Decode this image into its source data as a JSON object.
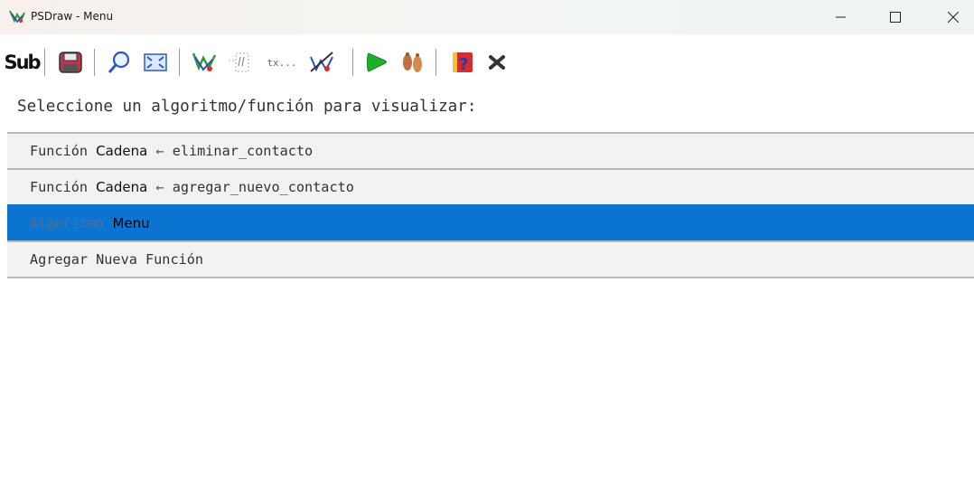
{
  "window": {
    "title": "PSDraw - Menu",
    "controls": {
      "minimize": "—",
      "maximize": "☐",
      "close": "✕"
    }
  },
  "toolbar": {
    "sub_label": "Sub",
    "tx_label": "tx...",
    "icons": [
      "sub-button",
      "save-icon",
      "search-icon",
      "fit-icon",
      "flowchart-icon",
      "dotted-tool-icon",
      "text-tool-icon",
      "edit-flowchart-icon",
      "run-icon",
      "step-icon",
      "help-icon",
      "close-icon"
    ]
  },
  "prompt": "Seleccione un algoritmo/función para visualizar:",
  "items": [
    {
      "prefix": "Función ",
      "name": "Cadena",
      "arrow": " ← ",
      "param": "eliminar_contacto",
      "selected": false
    },
    {
      "prefix": "Función ",
      "name": "Cadena",
      "arrow": " ← ",
      "param": "agregar_nuevo_contacto",
      "selected": false
    },
    {
      "prefix": "Algoritmo ",
      "name": "Menu",
      "selected": true
    },
    {
      "label": "Agregar Nueva Función",
      "selected": false
    }
  ],
  "colors": {
    "selection": "#0a74d0",
    "row_bg": "#f2f2f2",
    "row_border": "#b9b9b9"
  }
}
